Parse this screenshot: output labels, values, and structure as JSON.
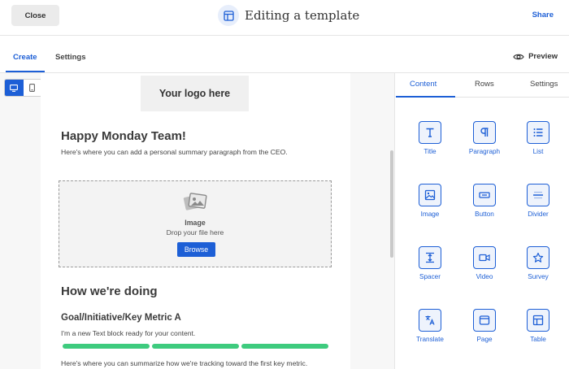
{
  "header": {
    "close_label": "Close",
    "title": "Editing a template",
    "share_label": "Share"
  },
  "subnav": {
    "tabs": [
      "Create",
      "Settings"
    ],
    "preview_label": "Preview"
  },
  "email": {
    "logo_placeholder": "Your logo here",
    "heading": "Happy Monday Team!",
    "intro": "Here's where you can add a personal summary paragraph from the CEO.",
    "image_block": {
      "title": "Image",
      "subtitle": "Drop your file here",
      "button": "Browse"
    },
    "section_heading": "How we're doing",
    "metric_heading": "Goal/Initiative/Key Metric A",
    "metric_text": "I'm a new Text block ready for your content.",
    "progress_segments": 3,
    "summary": "Here's where you can summarize how we're tracking toward the first key metric."
  },
  "panel": {
    "tabs": [
      "Content",
      "Rows",
      "Settings"
    ],
    "blocks": [
      {
        "label": "Title",
        "icon": "title-icon"
      },
      {
        "label": "Paragraph",
        "icon": "paragraph-icon"
      },
      {
        "label": "List",
        "icon": "list-icon"
      },
      {
        "label": "Image",
        "icon": "image-icon"
      },
      {
        "label": "Button",
        "icon": "button-icon"
      },
      {
        "label": "Divider",
        "icon": "divider-icon"
      },
      {
        "label": "Spacer",
        "icon": "spacer-icon"
      },
      {
        "label": "Video",
        "icon": "video-icon"
      },
      {
        "label": "Survey",
        "icon": "star-icon"
      },
      {
        "label": "Translate",
        "icon": "translate-icon"
      },
      {
        "label": "Page",
        "icon": "page-icon"
      },
      {
        "label": "Table",
        "icon": "table-icon"
      }
    ]
  },
  "colors": {
    "accent": "#1d5fd6",
    "progress": "#3ecb7e"
  }
}
